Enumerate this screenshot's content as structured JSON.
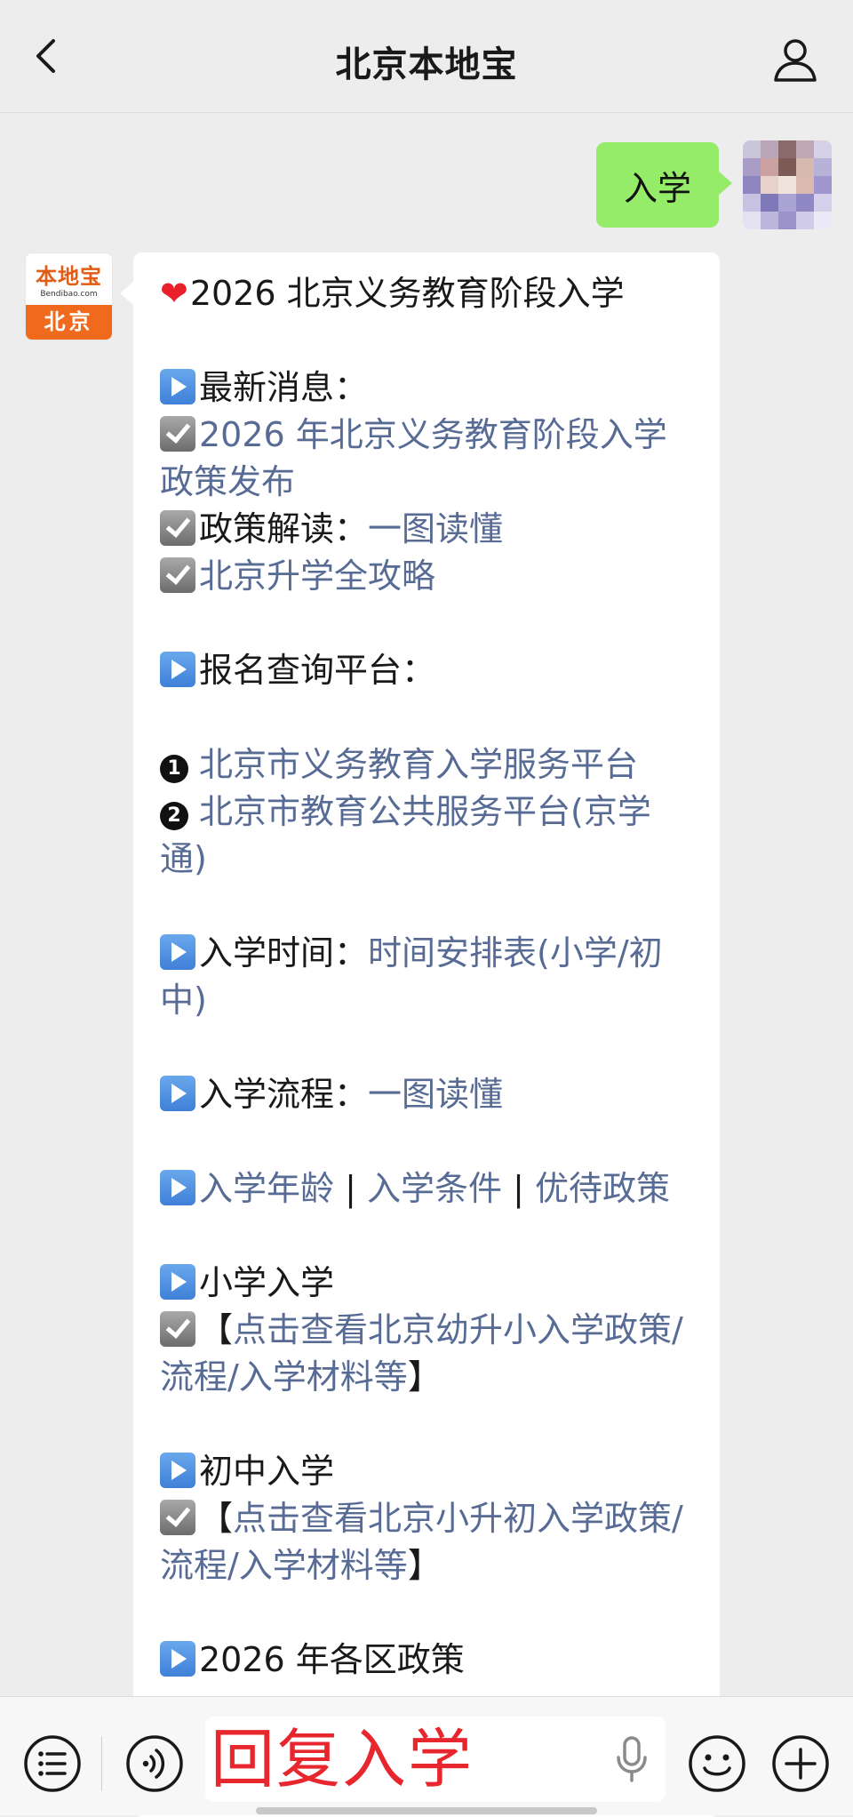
{
  "header": {
    "title": "北京本地宝",
    "back_icon": "chevron-left-icon",
    "profile_icon": "person-icon"
  },
  "user_message": {
    "text": "入学",
    "bubble_color": "#95ec69"
  },
  "bot": {
    "logo_main": "本地宝",
    "logo_sub": "Bendibao.com",
    "logo_city": "北京",
    "accent_color": "#ef6a1d"
  },
  "bot_message": {
    "heading": "2026 北京义务教育阶段入学",
    "latest_label": "最新消息：",
    "latest_link1": "2026 年北京义务教育阶段入学政策发布",
    "policy_label": "政策解读：",
    "policy_link": "一图读懂",
    "guide_link": "北京升学全攻略",
    "platform_label": "报名查询平台：",
    "platform1_num": "1",
    "platform1_link": "北京市义务教育入学服务平台",
    "platform2_num": "2",
    "platform2_link": "北京市教育公共服务平台(京学通)",
    "time_label": "入学时间：",
    "time_link": "时间安排表(小学/初中)",
    "process_label": "入学流程：",
    "process_link": "一图读懂",
    "age_link": "入学年龄",
    "sep": " | ",
    "cond_link": "入学条件",
    "pref_link": "优待政策",
    "primary_label": "小学入学",
    "bracket_open": "【",
    "bracket_close": "】",
    "primary_link": "点击查看北京幼升小入学政策/流程/入学材料等",
    "junior_label": "初中入学",
    "junior_link": "点击查看北京小升初入学政策/流程/入学材料等",
    "district_label": "2026 年各区政策",
    "link_color": "#576b95"
  },
  "input_bar": {
    "overlay_text": "回复入学",
    "overlay_color": "#e8262d",
    "icons": [
      "list-icon",
      "voice-icon",
      "microphone-icon",
      "emoji-icon",
      "plus-icon"
    ]
  }
}
